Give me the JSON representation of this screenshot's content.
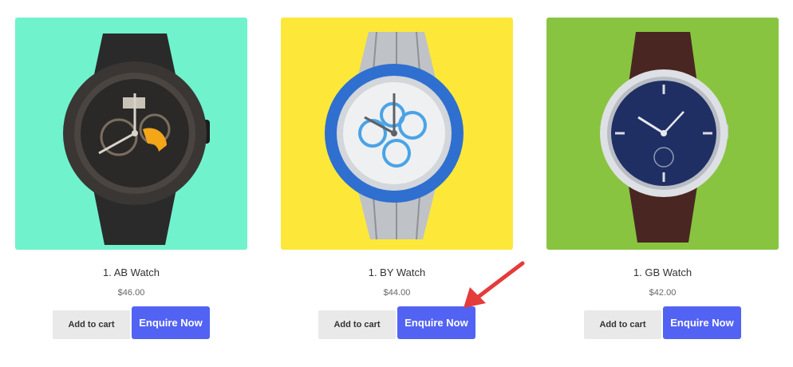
{
  "colors": {
    "enquire_button": "#5263f3",
    "add_to_cart_button": "#e9e9e9",
    "annotation_arrow": "#e43b3b"
  },
  "products": [
    {
      "title": "1. AB Watch",
      "price": "$46.00",
      "background": "#70f2cd",
      "add_to_cart_label": "Add to cart",
      "enquire_label": "Enquire Now",
      "image_icon": "black-chronograph-watch"
    },
    {
      "title": "1. BY Watch",
      "price": "$44.00",
      "background": "#fde83a",
      "add_to_cart_label": "Add to cart",
      "enquire_label": "Enquire Now",
      "image_icon": "silver-blue-chronograph-watch"
    },
    {
      "title": "1. GB Watch",
      "price": "$42.00",
      "background": "#88c440",
      "add_to_cart_label": "Add to cart",
      "enquire_label": "Enquire Now",
      "image_icon": "blue-dial-leather-watch"
    }
  ]
}
